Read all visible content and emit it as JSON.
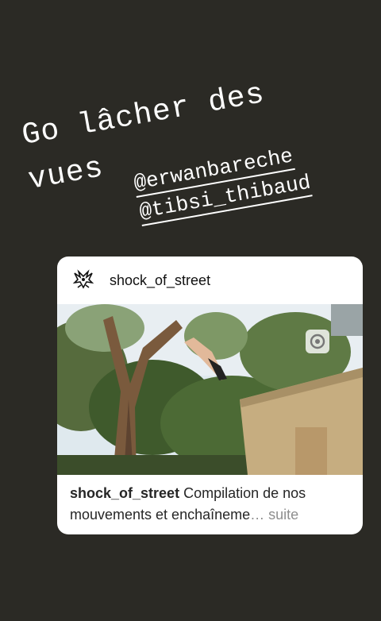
{
  "story": {
    "headline_line1": "Go lâcher des",
    "headline_line2": "vues",
    "mentions": [
      "@erwanbareche",
      "@tibsi_thibaud"
    ]
  },
  "post": {
    "username": "shock_of_street",
    "caption_username": "shock_of_street",
    "caption_text": " Compilation de nos mouvements et enchaîneme",
    "caption_more": "… suite",
    "avatar_icon": "bird-logo-icon",
    "media_icon": "video-icon"
  },
  "colors": {
    "background": "#2b2a25",
    "card": "#ffffff",
    "text_primary": "#262626",
    "text_muted": "#8e8e8e"
  }
}
